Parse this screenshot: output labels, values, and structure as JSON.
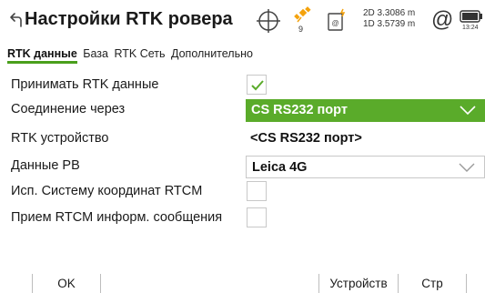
{
  "header": {
    "title": "Настройки RTK ровера",
    "satellites": "9",
    "quality_2d": "2D 3.3086 m",
    "quality_1d": "1D 3.5739 m",
    "at_symbol": "@",
    "time": "13:24",
    "icons": [
      "back-icon",
      "crosshair-icon",
      "satellite-icon",
      "rtk-device-icon",
      "at-icon",
      "battery-icon"
    ]
  },
  "tabs": [
    {
      "label": "RTK данные",
      "active": true
    },
    {
      "label": "База",
      "active": false
    },
    {
      "label": "RTK Сеть",
      "active": false
    },
    {
      "label": "Дополнительно",
      "active": false
    }
  ],
  "form": {
    "receive_rtk": {
      "label": "Принимать RTK данные",
      "checked": true
    },
    "connect_via": {
      "label": "Соединение через",
      "value": "CS RS232 порт"
    },
    "rtk_device": {
      "label": "RTK устройство",
      "value": "<CS RS232 порт>"
    },
    "ref_data": {
      "label": "Данные РВ",
      "value": "Leica 4G"
    },
    "use_rtcm_cs": {
      "label": "Исп. Систему координат RTCM",
      "checked": false
    },
    "rtcm_messages": {
      "label": "Прием RTCM информ. сообщения",
      "checked": false
    }
  },
  "softkeys": {
    "ok": "OK",
    "devices": "Устройств",
    "page": "Стр"
  },
  "colors": {
    "accent_green": "#5aab2a",
    "tab_underline": "#4a9f1c",
    "satellite_orange": "#f4a20c"
  }
}
